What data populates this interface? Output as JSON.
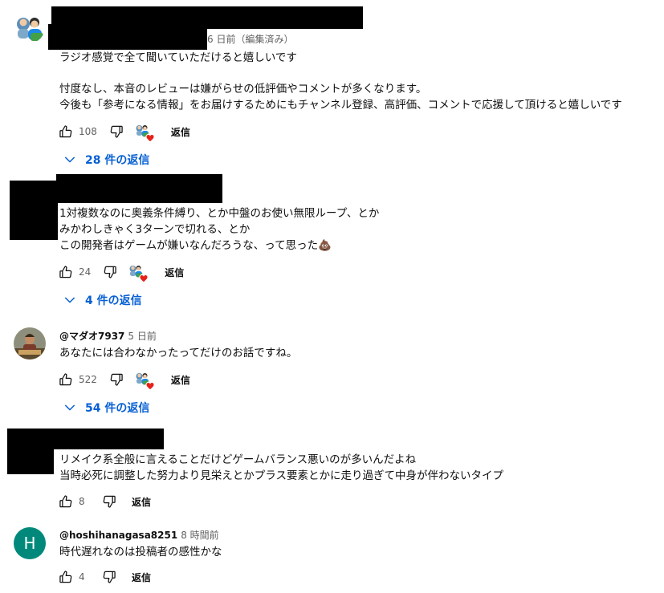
{
  "comments": [
    {
      "time": "6 日前（編集済み）",
      "lines": [
        "ラジオ感覚で全て聞いていただけると嬉しいです",
        "",
        "忖度なし、本音のレビューは嫌がらせの低評価やコメントが多くなります。",
        "今後も「参考になる情報」をお届けするためにもチャンネル登録、高評価、コメントで応援して頂けると嬉しいです"
      ],
      "likes": "108",
      "reply_label": "返信",
      "replies_label": "28 件の返信"
    },
    {
      "lines": [
        "1対複数なのに奥義条件縛り、とか中盤のお使い無限ループ、とか",
        "みかわしきゃく3ターンで切れる、とか",
        "この開発者はゲームが嫌いなんだろうな、って思った"
      ],
      "emoji": "💩",
      "likes": "24",
      "reply_label": "返信",
      "replies_label": "4 件の返信"
    },
    {
      "author": "@マダオ7937",
      "time": "5 日前",
      "lines": [
        "あなたには合わなかったってだけのお話ですね。"
      ],
      "likes": "522",
      "reply_label": "返信",
      "replies_label": "54 件の返信"
    },
    {
      "lines": [
        "リメイク系全般に言えることだけどゲームバランス悪いのが多いんだよね",
        "当時必死に調整した努力より見栄えとかプラス要素とかに走り過ぎて中身が伴わないタイプ"
      ],
      "likes": "8",
      "reply_label": "返信"
    },
    {
      "author": "@hoshihanagasa8251",
      "time": "8 時間前",
      "avatar_letter": "H",
      "lines": [
        "時代遅れなのは投稿者の感性かな"
      ],
      "likes": "4",
      "reply_label": "返信"
    }
  ],
  "colors": {
    "link": "#065fd4",
    "meta": "#606060",
    "avatar_h": "#00897b",
    "heart": "#e62117"
  },
  "icons": [
    "like-icon",
    "dislike-icon",
    "heart-icon",
    "chevron-down-icon"
  ]
}
